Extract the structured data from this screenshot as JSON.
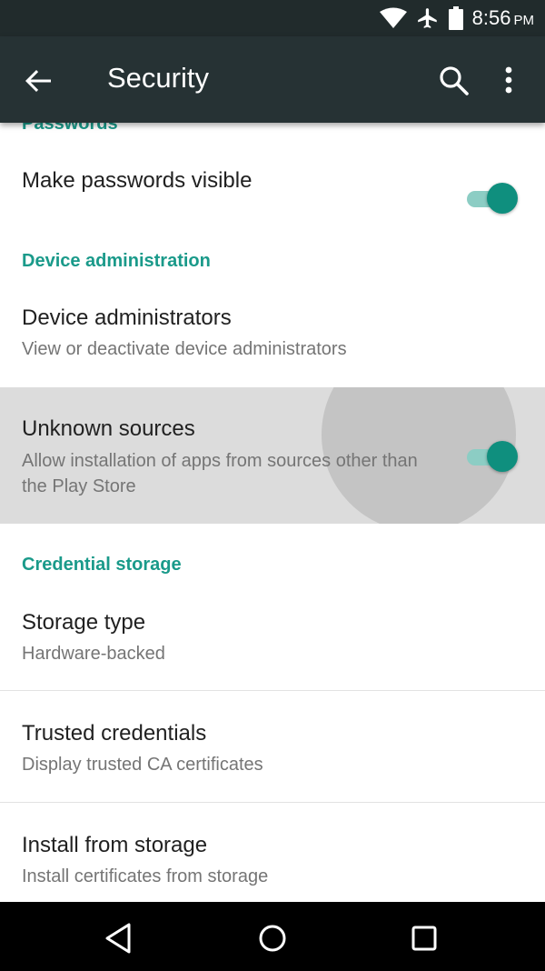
{
  "status_bar": {
    "time": "8:56",
    "ampm": "PM",
    "icons": [
      "wifi-icon",
      "airplane-icon",
      "battery-icon"
    ]
  },
  "toolbar": {
    "title": "Security",
    "icons": [
      "back-arrow-icon",
      "search-icon",
      "more-vert-icon"
    ]
  },
  "sections": {
    "passwords": {
      "header": "Passwords",
      "make_passwords_visible": {
        "title": "Make passwords visible",
        "toggle_on": true
      }
    },
    "device_administration": {
      "header": "Device administration",
      "device_administrators": {
        "title": "Device administrators",
        "summary": "View or deactivate device administrators"
      },
      "unknown_sources": {
        "title": "Unknown sources",
        "summary": "Allow installation of apps from sources other than the Play Store",
        "toggle_on": true,
        "pressed": true
      }
    },
    "credential_storage": {
      "header": "Credential storage",
      "storage_type": {
        "title": "Storage type",
        "summary": "Hardware-backed"
      },
      "trusted_credentials": {
        "title": "Trusted credentials",
        "summary": "Display trusted CA certificates"
      },
      "install_from_storage": {
        "title": "Install from storage",
        "summary": "Install certificates from storage"
      }
    }
  },
  "nav_bar": {
    "icons": [
      "back-triangle-icon",
      "home-circle-icon",
      "recents-square-icon"
    ]
  },
  "colors": {
    "accent": "#1a9a8a",
    "toggle_thumb": "#0f8f7e",
    "toggle_track": "#8ccdc4",
    "toolbar": "#263234",
    "status_bar": "#212b2c"
  }
}
